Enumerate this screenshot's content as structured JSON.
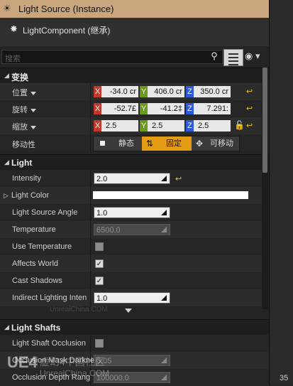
{
  "header": {
    "title": "Light Source (Instance)",
    "icon": "light-source-icon"
  },
  "component": {
    "label": "LightComponent (继承)",
    "icon": "light-component-icon"
  },
  "search": {
    "placeholder": "搜索"
  },
  "toolbar": {
    "search_icon": "search-icon",
    "list_icon": "list-view-icon",
    "eye_icon": "eye-icon"
  },
  "transform": {
    "section": "变换",
    "location": {
      "label": "位置",
      "x": "-34.0 cr",
      "y": "406.0 cr",
      "z": "350.0 cr"
    },
    "rotation": {
      "label": "旋转",
      "x": "-52.7£",
      "y": "-41.2‡",
      "z": "7.291:"
    },
    "scale": {
      "label": "缩放",
      "x": "2.5",
      "y": "2.5",
      "z": "2.5"
    },
    "mobility": {
      "label": "移动性",
      "static": "静态",
      "stationary": "固定",
      "movable": "可移动",
      "selected": "stationary"
    },
    "axes": {
      "x": "X",
      "y": "Y",
      "z": "Z"
    }
  },
  "light": {
    "section": "Light",
    "intensity": {
      "label": "Intensity",
      "value": "2.0"
    },
    "light_color": {
      "label": "Light Color",
      "value": "#ffffff"
    },
    "light_source_angle": {
      "label": "Light Source Angle",
      "value": "1.0"
    },
    "temperature": {
      "label": "Temperature",
      "value": "6500.0"
    },
    "use_temperature": {
      "label": "Use Temperature",
      "checked": false
    },
    "affects_world": {
      "label": "Affects World",
      "checked": true
    },
    "cast_shadows": {
      "label": "Cast Shadows",
      "checked": true
    },
    "indirect_lighting": {
      "label": "Indirect Lighting Inten",
      "value": "1.0"
    }
  },
  "light_shafts": {
    "section": "Light Shafts",
    "occlusion": {
      "label": "Light Shaft Occlusion",
      "checked": false
    },
    "mask_darkness": {
      "label": "Occlusion Mask Darkne",
      "value": "0.05"
    },
    "depth_range": {
      "label": "Occlusion Depth Rang",
      "value": "100000.0"
    }
  },
  "watermark": {
    "site": "UnrealChina.COM",
    "brand": "虚幻4中国社区"
  },
  "side_number": "35",
  "colors": {
    "header_bg": "#caa67e",
    "accent": "#e39c14",
    "axis_x": "#c03a2b",
    "axis_y": "#6a9a18",
    "axis_z": "#2f5ad7"
  }
}
